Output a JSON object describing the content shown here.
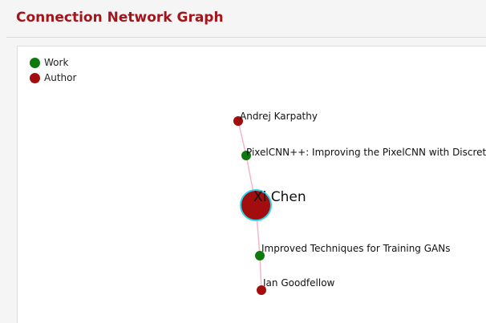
{
  "panel_title": "Connection Network Graph",
  "legend": [
    {
      "label": "Work",
      "color": "#0b7a0b",
      "icon": "circle-icon"
    },
    {
      "label": "Author",
      "color": "#a30d0d",
      "icon": "circle-icon"
    }
  ],
  "colors": {
    "work": "#0b7a0b",
    "author": "#a30d0d",
    "edge": "#f4b6c8",
    "focus_ring": "#29d4ee"
  },
  "graph": {
    "focus_node": "Xi Chen",
    "nodes": [
      {
        "id": "andrej",
        "label": "Andrej Karpathy",
        "type": "author"
      },
      {
        "id": "pixelcnn",
        "label": "PixelCNN++: Improving the PixelCNN with Discretiz",
        "type": "work"
      },
      {
        "id": "xichen",
        "label": "Xi Chen",
        "type": "author",
        "focus": true
      },
      {
        "id": "gans",
        "label": "Improved Techniques for Training GANs",
        "type": "work"
      },
      {
        "id": "ian",
        "label": "Ian Goodfellow",
        "type": "author"
      }
    ],
    "edges": [
      [
        "andrej",
        "pixelcnn"
      ],
      [
        "pixelcnn",
        "xichen"
      ],
      [
        "xichen",
        "gans"
      ],
      [
        "gans",
        "ian"
      ]
    ]
  }
}
